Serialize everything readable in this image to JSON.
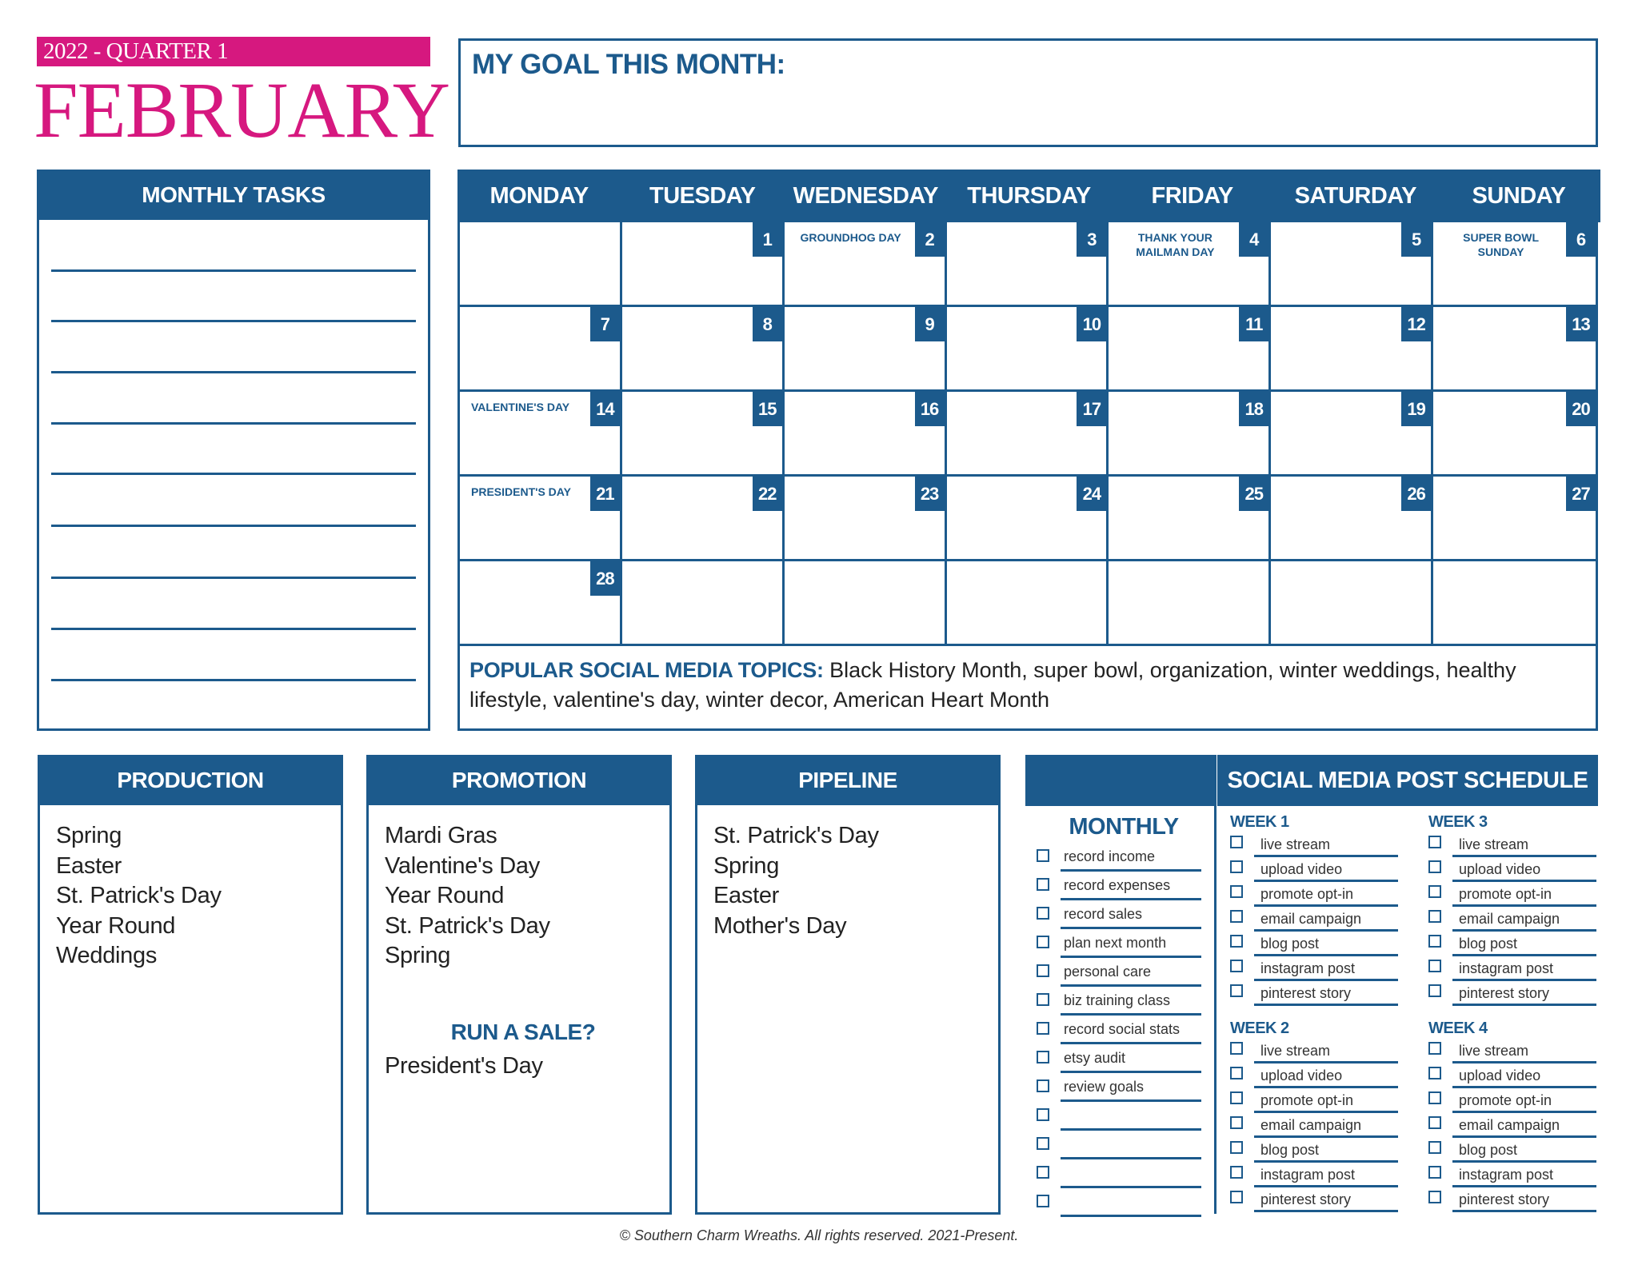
{
  "header": {
    "quarter_label": "2022 - QUARTER 1",
    "month_title": "FEBRUARY",
    "goal_label": "MY GOAL THIS MONTH:"
  },
  "colors": {
    "primary_blue": "#1c5a8c",
    "accent_pink": "#d6187f"
  },
  "monthly_tasks": {
    "title": "MONTHLY TASKS",
    "blank_lines": 9
  },
  "calendar": {
    "weekdays": [
      "MONDAY",
      "TUESDAY",
      "WEDNESDAY",
      "THURSDAY",
      "FRIDAY",
      "SATURDAY",
      "SUNDAY"
    ],
    "cells": [
      {
        "day": "",
        "holiday": ""
      },
      {
        "day": "1",
        "holiday": ""
      },
      {
        "day": "2",
        "holiday": "GROUNDHOG DAY"
      },
      {
        "day": "3",
        "holiday": ""
      },
      {
        "day": "4",
        "holiday": "THANK YOUR MAILMAN DAY"
      },
      {
        "day": "5",
        "holiday": ""
      },
      {
        "day": "6",
        "holiday": "SUPER BOWL SUNDAY"
      },
      {
        "day": "7",
        "holiday": ""
      },
      {
        "day": "8",
        "holiday": ""
      },
      {
        "day": "9",
        "holiday": ""
      },
      {
        "day": "10",
        "holiday": ""
      },
      {
        "day": "11",
        "holiday": ""
      },
      {
        "day": "12",
        "holiday": ""
      },
      {
        "day": "13",
        "holiday": ""
      },
      {
        "day": "14",
        "holiday": "VALENTINE'S DAY"
      },
      {
        "day": "15",
        "holiday": ""
      },
      {
        "day": "16",
        "holiday": ""
      },
      {
        "day": "17",
        "holiday": ""
      },
      {
        "day": "18",
        "holiday": ""
      },
      {
        "day": "19",
        "holiday": ""
      },
      {
        "day": "20",
        "holiday": ""
      },
      {
        "day": "21",
        "holiday": "PRESIDENT'S DAY"
      },
      {
        "day": "22",
        "holiday": ""
      },
      {
        "day": "23",
        "holiday": ""
      },
      {
        "day": "24",
        "holiday": ""
      },
      {
        "day": "25",
        "holiday": ""
      },
      {
        "day": "26",
        "holiday": ""
      },
      {
        "day": "27",
        "holiday": ""
      },
      {
        "day": "28",
        "holiday": ""
      },
      {
        "day": "",
        "holiday": ""
      },
      {
        "day": "",
        "holiday": ""
      },
      {
        "day": "",
        "holiday": ""
      },
      {
        "day": "",
        "holiday": ""
      },
      {
        "day": "",
        "holiday": ""
      },
      {
        "day": "",
        "holiday": ""
      }
    ],
    "topics_label": "POPULAR SOCIAL MEDIA TOPICS:",
    "topics_text": " Black History Month, super bowl, organization, winter weddings, healthy lifestyle, valentine's day, winter decor, American Heart Month"
  },
  "production": {
    "title": "PRODUCTION",
    "items": [
      "Spring",
      "Easter",
      "St. Patrick's Day",
      "Year Round",
      "Weddings"
    ]
  },
  "promotion": {
    "title": "PROMOTION",
    "items": [
      "Mardi Gras",
      "Valentine's Day",
      "Year Round",
      "St. Patrick's Day",
      "Spring"
    ],
    "sale_title": "RUN A SALE?",
    "sale_items": [
      "President's Day"
    ]
  },
  "pipeline": {
    "title": "PIPELINE",
    "items": [
      "St. Patrick's Day",
      "Spring",
      "Easter",
      "Mother's Day"
    ]
  },
  "social_schedule": {
    "title": "SOCIAL MEDIA POST SCHEDULE",
    "monthly": {
      "title": "MONTHLY",
      "items": [
        "record income",
        "record expenses",
        "record sales",
        "plan next month",
        "personal care",
        "biz training class",
        "record social stats",
        "etsy audit",
        "review goals",
        "",
        "",
        "",
        ""
      ]
    },
    "weeks": [
      {
        "title": "WEEK 1",
        "items": [
          "live stream",
          "upload video",
          "promote opt-in",
          "email campaign",
          "blog post",
          "instagram post",
          "pinterest story"
        ]
      },
      {
        "title": "WEEK 2",
        "items": [
          "live stream",
          "upload video",
          "promote opt-in",
          "email campaign",
          "blog post",
          "instagram post",
          "pinterest story"
        ]
      },
      {
        "title": "WEEK 3",
        "items": [
          "live stream",
          "upload video",
          "promote opt-in",
          "email campaign",
          "blog post",
          "instagram post",
          "pinterest story"
        ]
      },
      {
        "title": "WEEK 4",
        "items": [
          "live stream",
          "upload video",
          "promote opt-in",
          "email campaign",
          "blog post",
          "instagram post",
          "pinterest story"
        ]
      }
    ]
  },
  "footer": {
    "copyright": "© Southern Charm Wreaths. All rights reserved. 2021-Present."
  }
}
